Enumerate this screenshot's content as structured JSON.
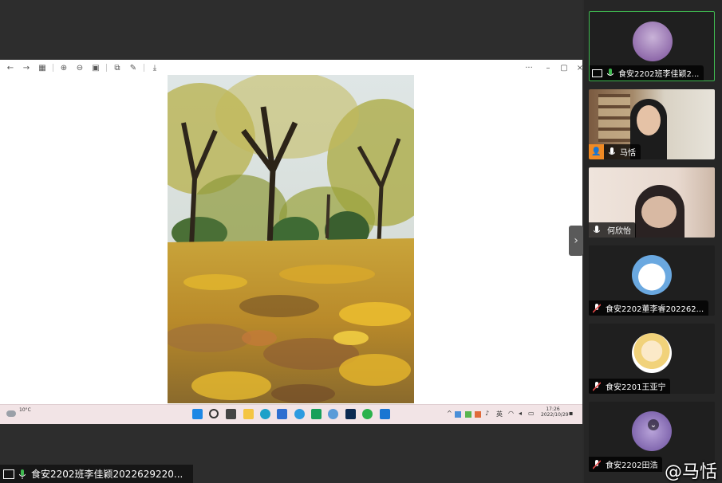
{
  "viewer": {
    "toolbar": {
      "back": "←",
      "forward": "→",
      "gallery": "▦",
      "zoom_in": "⊕",
      "zoom_out": "⊖",
      "fit": "▣",
      "crop": "⧉",
      "edit": "✎",
      "save": "⤓",
      "more": "···",
      "minimize": "–",
      "restore": "▢",
      "close": "×"
    },
    "photo": {
      "subject": "autumn tree-lined path covered with yellow fallen leaves"
    }
  },
  "taskbar": {
    "weather_temp": "10°C",
    "lang": "英",
    "time": "17:26",
    "date": "2022/10/29",
    "apps": [
      "windows",
      "search",
      "task-view",
      "explorer",
      "edge",
      "store",
      "browser",
      "mail",
      "qq",
      "photoshop",
      "wechat",
      "app"
    ]
  },
  "sharer": {
    "label": "食安2202班李佳颖2022629220..."
  },
  "participants": [
    {
      "name": "食安2202班李佳颖2...",
      "mic": "on",
      "sharing": true,
      "active": true,
      "type": "avatar",
      "accent": "#9b6fb0"
    },
    {
      "name": "马恬",
      "mic": "on",
      "host": true,
      "type": "video"
    },
    {
      "name": "何欣怡",
      "mic": "on",
      "type": "video"
    },
    {
      "name": "食安2202董李睿202262...",
      "mic": "off",
      "type": "avatar",
      "accent": "#6aa8e0"
    },
    {
      "name": "食安2201王亚宁",
      "mic": "off",
      "type": "avatar",
      "accent": "#f1d27a"
    },
    {
      "name": "食安2202田浩",
      "mic": "off",
      "type": "avatar",
      "accent": "#6b4f9e"
    }
  ],
  "watermark": "@马恬",
  "colors": {
    "active_border": "#3fb950",
    "mic_on": "#3fb950",
    "mic_off": "#e04848"
  }
}
